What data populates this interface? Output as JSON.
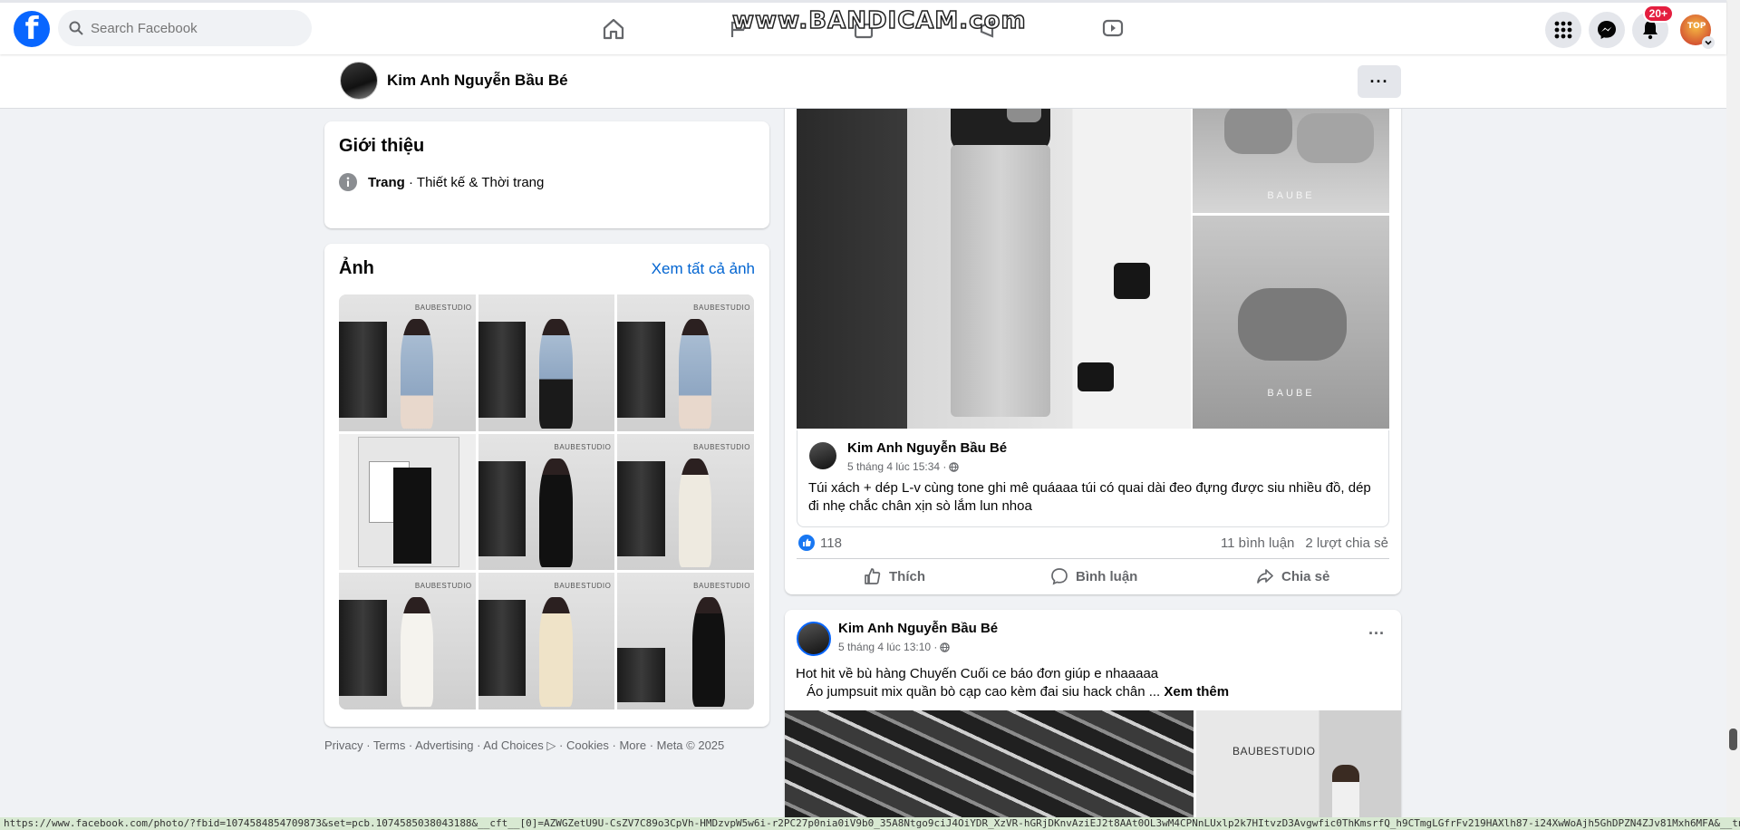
{
  "topbar": {
    "search_placeholder": "Search Facebook",
    "watermark": "www.BANDICAM.com",
    "notifications_badge": "20+",
    "profile_badge": "TOP"
  },
  "page": {
    "name": "Kim Anh Nguyễn Bầu Bé",
    "more_label": "···"
  },
  "intro": {
    "title": "Giới thiệu",
    "category_bold": "Trang",
    "category_rest": " · Thiết kế & Thời trang"
  },
  "photos": {
    "title": "Ảnh",
    "see_all": "Xem tất cả ảnh",
    "tile_logos": [
      "BAUBESTUDIO",
      "",
      "BAUBESTUDIO",
      "",
      "BAUBESTUDIO",
      "BAUBESTUDIO",
      "BAUBESTUDIO",
      "BAUBESTUDIO",
      "BAUBESTUDIO"
    ]
  },
  "footer": {
    "text": "Privacy · Terms · Advertising · Ad Choices ▷ · Cookies · More · Meta © 2025"
  },
  "post1": {
    "image_logo": "BAUBE",
    "shared": {
      "author": "Kim Anh Nguyễn Bầu Bé",
      "time": "5 tháng 4 lúc 15:34 ·",
      "text": "Túi xách + dép L-v cùng tone ghi mê quáaaa túi có quai dài đeo đựng được siu nhiều đồ, dép đi nhẹ chắc chân xịn sò lắm lun nhoa"
    },
    "likes": "118",
    "comments": "11 bình luận",
    "shares": "2 lượt chia sẻ",
    "actions": {
      "like": "Thích",
      "comment": "Bình luận",
      "share": "Chia sẻ"
    }
  },
  "post2": {
    "author": "Kim Anh Nguyễn Bầu Bé",
    "time": "5 tháng 4 lúc 13:10 ·",
    "line1": "Hot hit về bù hàng Chuyến Cuối ce báo đơn giúp e nhaaaaa",
    "line2": "Áo jumpsuit mix quần bò cạp cao kèm đai siu hack chân ...",
    "see_more": "Xem thêm",
    "image_logo": "BAUBESTUDIO"
  },
  "statusbar": {
    "url": "https://www.facebook.com/photo/?fbid=1074584854709873&set=pcb.1074585038043188&__cft__[0]=AZWGZetU9U-CsZV7C89o3CpVh-HMDzvpW5w6i-r2PC27p0nia0iV9b0_35A8Ntgo9ciJ4OiYDR_XzVR-hGRjDKnvAziEJ2t8AAt0OL3wM4CPNnLUxlp2k7HItvzD3Avgwfic0ThKmsrfQ_h9CTmgLGfrFv219HAXlh87-i24XwWoAjh5GhDPZN4ZJv81Mxh6MFA&__tn__=..."
  },
  "colors": {
    "brand": "#0866ff",
    "link": "#0064d1",
    "background": "#f0f2f5"
  }
}
